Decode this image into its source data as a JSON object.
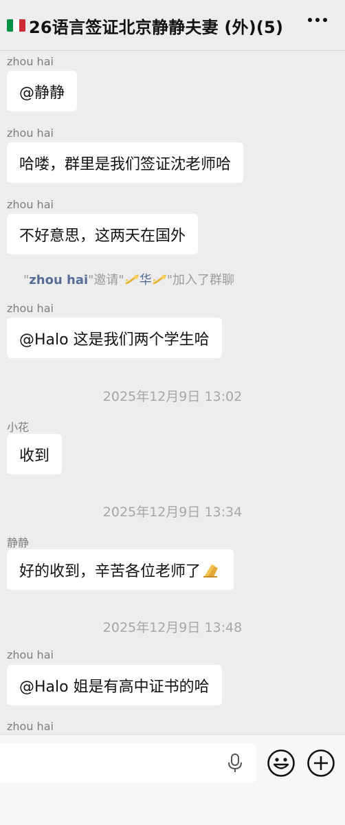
{
  "header": {
    "title": "26语言签证北京静静夫妻 (外)(5)",
    "flag_colors": [
      "#009246",
      "#ffffff",
      "#ce2b37"
    ],
    "more_icon": "more-dots-icon"
  },
  "messages": [
    {
      "sender": "zhou hai",
      "text": "@静静"
    },
    {
      "sender": "zhou hai",
      "text": "哈喽，群里是我们签证沈老师哈"
    },
    {
      "sender": "zhou hai",
      "text": "不好意思，这两天在国外"
    },
    {
      "sender": "zhou hai",
      "text": "@Halo 这是我们两个学生哈"
    },
    {
      "sender": "小花",
      "text": "收到"
    },
    {
      "sender": "静静",
      "text": "好的收到，辛苦各位老师了"
    },
    {
      "sender": "zhou hai",
      "text": "@Halo 姐是有高中证书的哈"
    },
    {
      "sender": "zhou hai",
      "text": ""
    }
  ],
  "system_notice": {
    "quote_open": "\"",
    "inviter": "zhou hai",
    "mid": "\"邀请\"",
    "invitee": "华",
    "end": "\"加入了群聊"
  },
  "timestamps": [
    "2025年12月9日 13:02",
    "2025年12月9日 13:34",
    "2025年12月9日 13:48"
  ],
  "input_bar": {
    "text_value": "",
    "icons": [
      "microphone-icon",
      "emoji-icon",
      "plus-icon"
    ]
  },
  "colors": {
    "background": "#ededed",
    "bubble": "#ffffff",
    "name_link": "#586c94",
    "muted": "#9c9c9c"
  }
}
